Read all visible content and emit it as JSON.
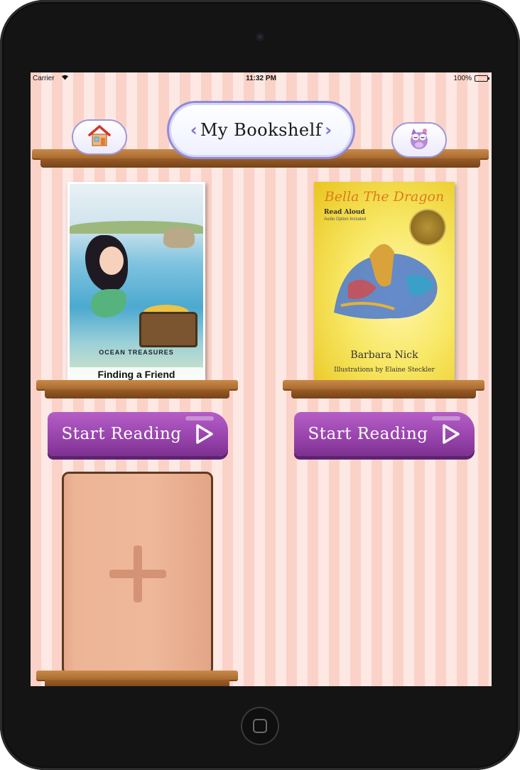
{
  "status_bar": {
    "carrier": "Carrier",
    "time": "11:32 PM",
    "battery": "100%",
    "battery_level": 1.0
  },
  "header": {
    "title": "My Bookshelf",
    "home_icon": "house-icon",
    "profile_icon": "owl-icon"
  },
  "books": [
    {
      "series": "OCEAN TREASURES",
      "title": "Finding a Friend",
      "button_label": "Start Reading",
      "button_icon": "play-icon"
    },
    {
      "title": "Bella The Dragon",
      "read_aloud": "Read Aloud",
      "read_aloud_sub": "Audio Option Included",
      "author": "Barbara Nick",
      "illustrator": "Illustrations by Elaine Steckler",
      "button_label": "Start Reading",
      "button_icon": "play-icon"
    }
  ],
  "add_book": {
    "icon": "plus-icon"
  },
  "colors": {
    "button_purple": "#9a45ae",
    "shelf_wood": "#a96a30",
    "stripe_pink": "#fbd2c8",
    "banner_border": "#8f8ad8"
  }
}
